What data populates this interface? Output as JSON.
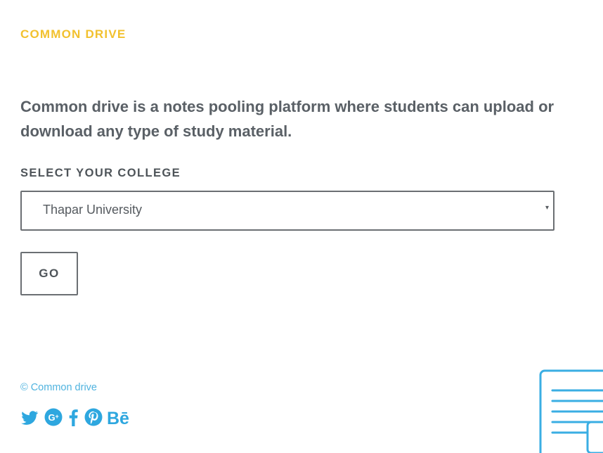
{
  "brand": {
    "title": "COMMON DRIVE"
  },
  "intro": {
    "text": "Common drive is a notes pooling platform where students can upload or download any type of study material."
  },
  "college_select": {
    "label": "SELECT YOUR COLLEGE",
    "selected": "Thapar University",
    "arrow": "▾"
  },
  "go_button": {
    "label": "GO"
  },
  "footer": {
    "copyright": "© Common drive",
    "social": [
      {
        "icon": "twitter-icon"
      },
      {
        "icon": "google-plus-icon"
      },
      {
        "icon": "facebook-icon"
      },
      {
        "icon": "pinterest-icon"
      },
      {
        "icon": "behance-icon",
        "text": "Bē"
      }
    ]
  },
  "colors": {
    "accent_yellow": "#f2c12e",
    "link_blue": "#4fb3df",
    "icon_blue": "#2ea7df",
    "text_gray": "#5a6066"
  }
}
